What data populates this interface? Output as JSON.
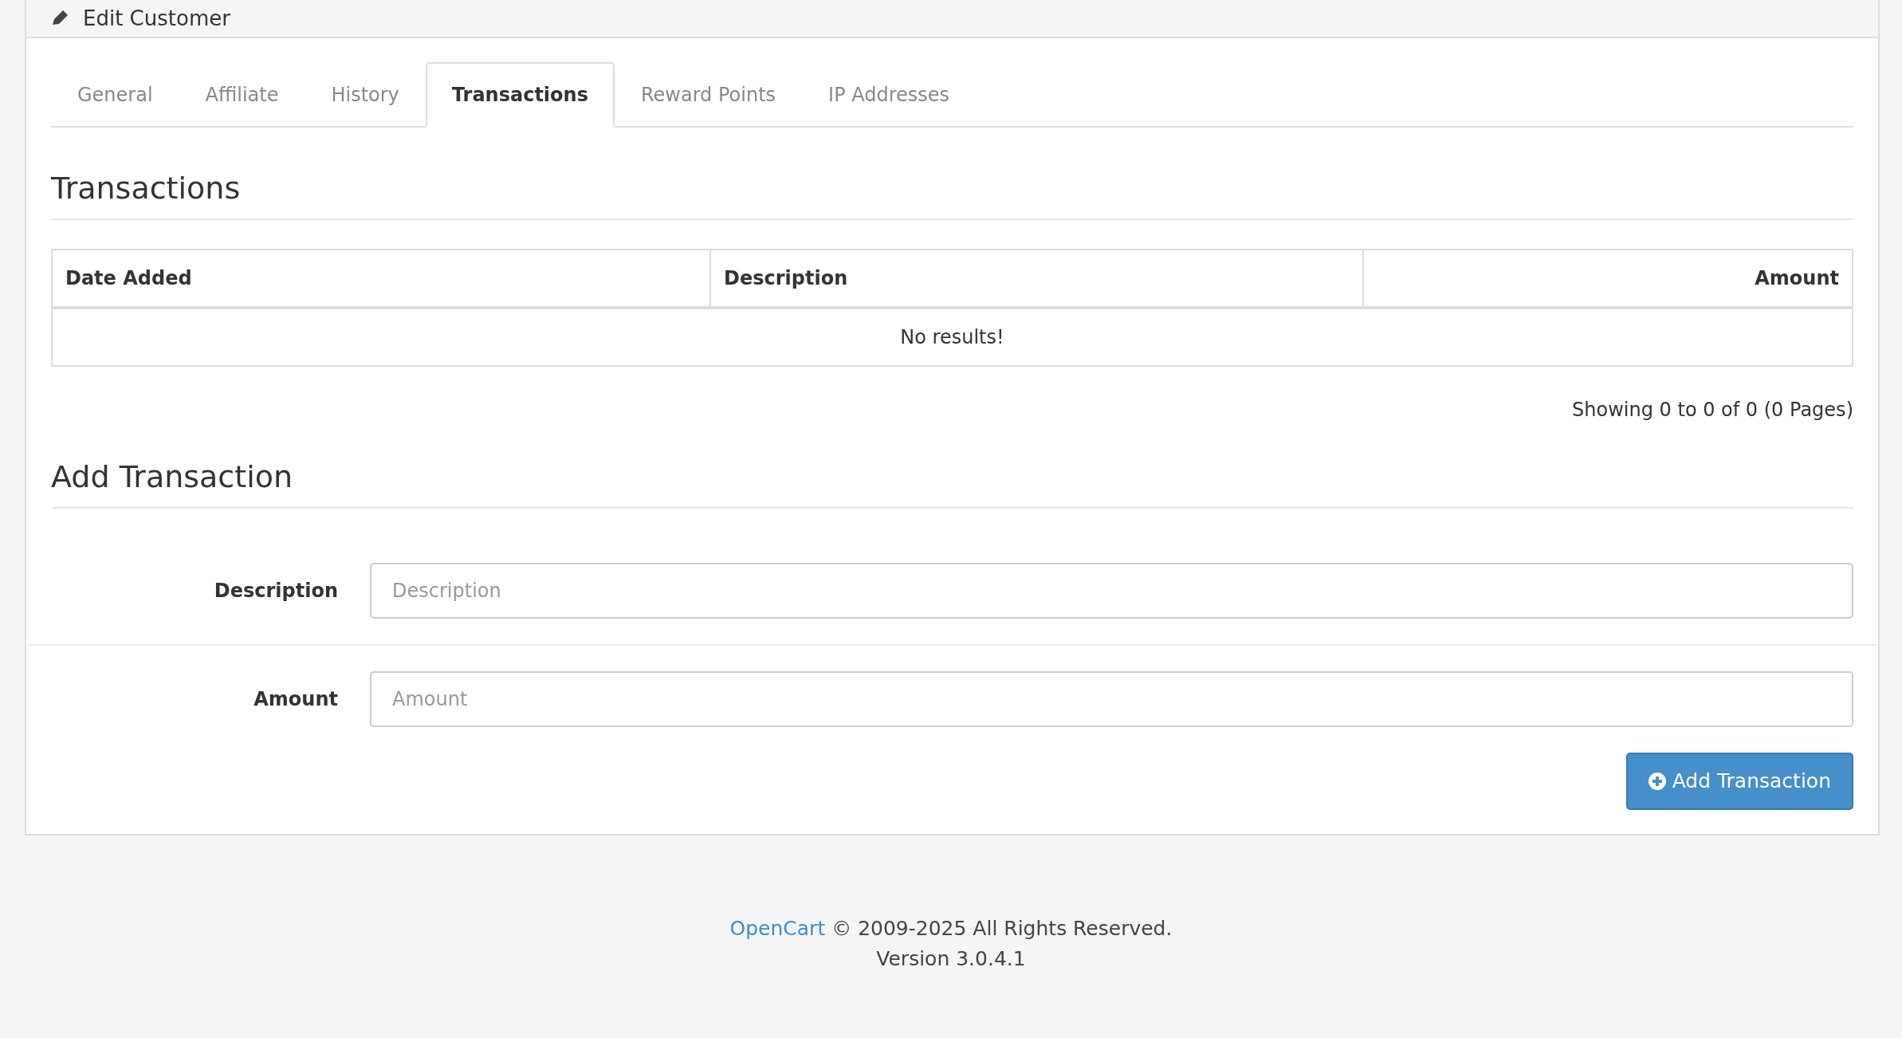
{
  "page_header": {
    "title": "Edit Customer"
  },
  "tabs": [
    {
      "label": "General",
      "selected": false
    },
    {
      "label": "Affiliate",
      "selected": false
    },
    {
      "label": "History",
      "selected": false
    },
    {
      "label": "Transactions",
      "selected": true
    },
    {
      "label": "Reward Points",
      "selected": false
    },
    {
      "label": "IP Addresses",
      "selected": false
    }
  ],
  "transactions": {
    "heading": "Transactions",
    "columns": [
      {
        "label": "Date Added"
      },
      {
        "label": "Description"
      },
      {
        "label": "Amount"
      }
    ],
    "empty_message": "No results!",
    "pagination": "Showing 0 to 0 of 0 (0 Pages)"
  },
  "add_transaction": {
    "heading": "Add Transaction",
    "fields": [
      {
        "label": "Description",
        "placeholder": "Description"
      },
      {
        "label": "Amount",
        "placeholder": "Amount"
      }
    ],
    "button": "Add Transaction"
  },
  "footer": {
    "link": "OpenCart",
    "text": "© 2009-2025 All Rights Reserved.",
    "version": "Version 3.0.4.1"
  }
}
